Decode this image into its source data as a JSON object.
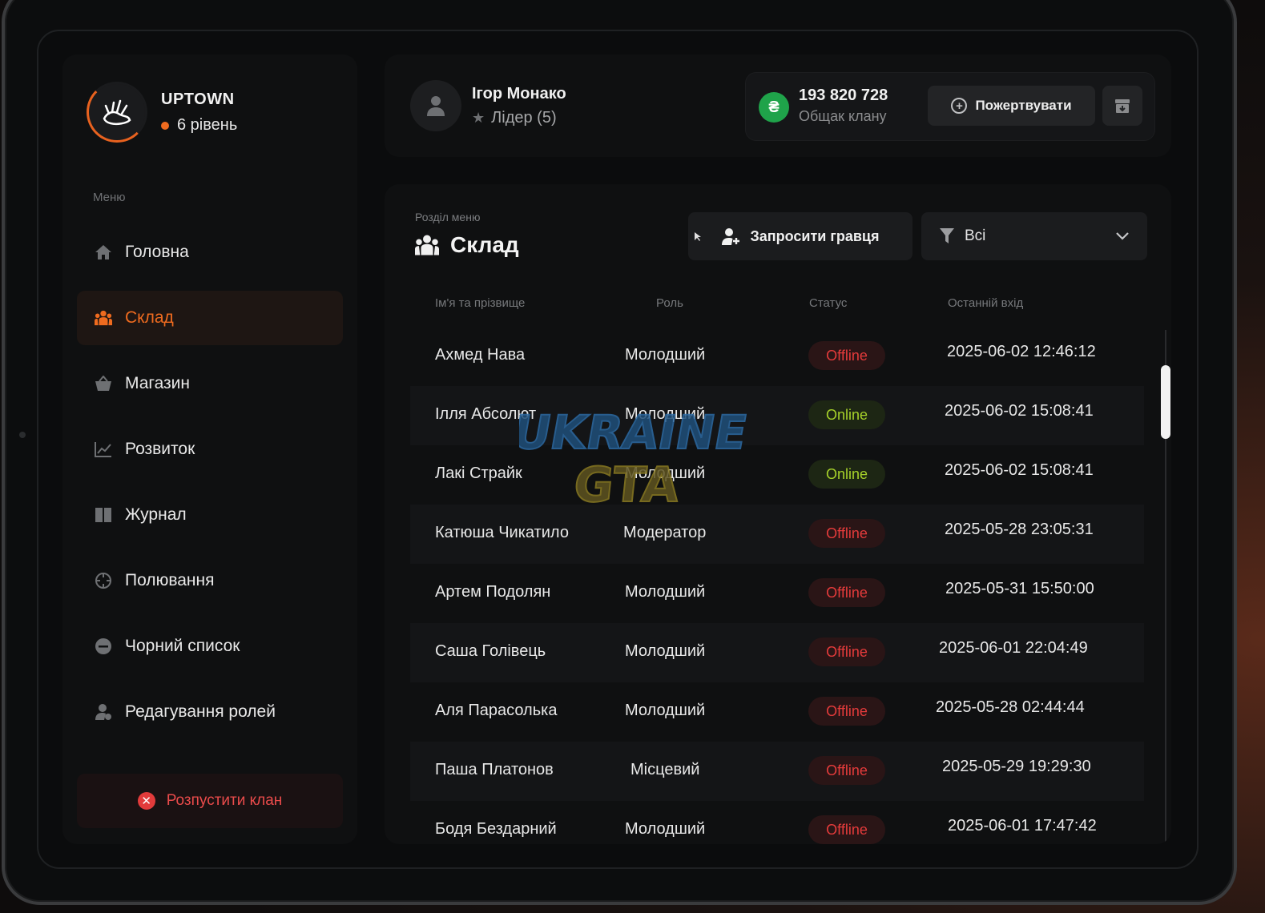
{
  "clan": {
    "name": "UPTOWN",
    "level": "6 рівень"
  },
  "sidebar": {
    "caption": "Меню",
    "items": [
      {
        "label": "Головна",
        "icon": "home-icon",
        "active": false
      },
      {
        "label": "Склад",
        "icon": "people-icon",
        "active": true
      },
      {
        "label": "Магазин",
        "icon": "basket-icon",
        "active": false
      },
      {
        "label": "Розвиток",
        "icon": "chart-icon",
        "active": false
      },
      {
        "label": "Журнал",
        "icon": "book-icon",
        "active": false
      },
      {
        "label": "Полювання",
        "icon": "crosshair-icon",
        "active": false
      },
      {
        "label": "Чорний список",
        "icon": "minus-circle-icon",
        "active": false
      },
      {
        "label": "Редагування ролей",
        "icon": "user-cog-icon",
        "active": false
      }
    ],
    "disband_label": "Розпустити клан"
  },
  "user": {
    "name": "Ігор Монако",
    "role": "Лідер (5)"
  },
  "bank": {
    "amount": "193 820 728",
    "caption": "Общак клану",
    "currency_symbol": "₴",
    "donate_label": "Пожертвувати"
  },
  "section": {
    "caption": "Розділ меню",
    "title": "Склад"
  },
  "toolbar": {
    "invite_label": "Запросити гравця",
    "filter_value": "Всі"
  },
  "table": {
    "headers": {
      "name": "Ім'я та прізвище",
      "role": "Роль",
      "status": "Статус",
      "last": "Останній вхід"
    },
    "rows": [
      {
        "name": "Ахмед Нава",
        "role": "Молодший",
        "status": "Offline",
        "last": "2025-06-02 12:46:12"
      },
      {
        "name": "Ілля Абсолют",
        "role": "Молодший",
        "status": "Online",
        "last": "2025-06-02 15:08:41"
      },
      {
        "name": "Лакі Страйк",
        "role": "Молодший",
        "status": "Online",
        "last": "2025-06-02 15:08:41"
      },
      {
        "name": "Катюша Чикатило",
        "role": "Модератор",
        "status": "Offline",
        "last": "2025-05-28 23:05:31"
      },
      {
        "name": "Артем Подолян",
        "role": "Молодший",
        "status": "Offline",
        "last": "2025-05-31 15:50:00"
      },
      {
        "name": "Саша Голівець",
        "role": "Молодший",
        "status": "Offline",
        "last": "2025-06-01 22:04:49"
      },
      {
        "name": "Аля Парасолька",
        "role": "Молодший",
        "status": "Offline",
        "last": "2025-05-28 02:44:44"
      },
      {
        "name": "Паша Платонов",
        "role": "Місцевий",
        "status": "Offline",
        "last": "2025-05-29 19:29:30"
      },
      {
        "name": "Бодя Бездарний",
        "role": "Молодший",
        "status": "Offline",
        "last": "2025-06-01 17:47:42"
      }
    ]
  },
  "watermark": {
    "line1": "UKRAINE",
    "line2": "GTA"
  },
  "colors": {
    "accent": "#ef6b1f",
    "online": "#a6d12a",
    "offline": "#e43b3b",
    "money": "#1fa34a"
  }
}
